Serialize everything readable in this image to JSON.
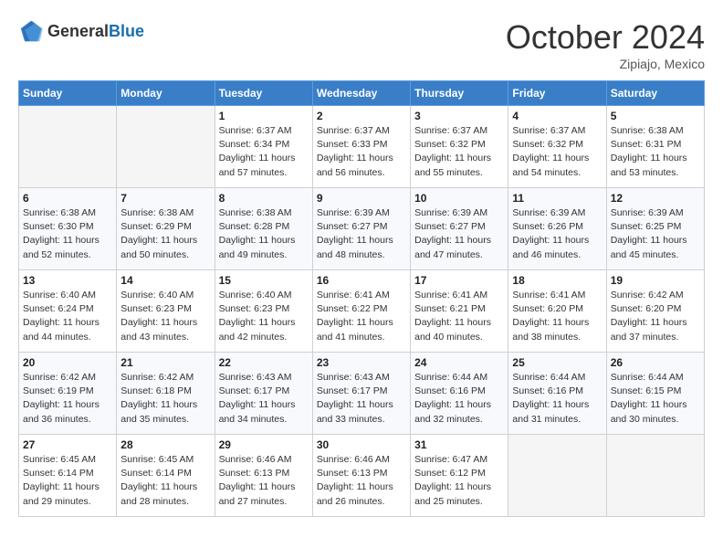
{
  "header": {
    "logo_general": "General",
    "logo_blue": "Blue",
    "month_title": "October 2024",
    "location": "Zipiajo, Mexico"
  },
  "weekdays": [
    "Sunday",
    "Monday",
    "Tuesday",
    "Wednesday",
    "Thursday",
    "Friday",
    "Saturday"
  ],
  "weeks": [
    [
      null,
      null,
      {
        "day": 1,
        "sunrise": "6:37 AM",
        "sunset": "6:34 PM",
        "daylight": "11 hours and 57 minutes."
      },
      {
        "day": 2,
        "sunrise": "6:37 AM",
        "sunset": "6:33 PM",
        "daylight": "11 hours and 56 minutes."
      },
      {
        "day": 3,
        "sunrise": "6:37 AM",
        "sunset": "6:32 PM",
        "daylight": "11 hours and 55 minutes."
      },
      {
        "day": 4,
        "sunrise": "6:37 AM",
        "sunset": "6:32 PM",
        "daylight": "11 hours and 54 minutes."
      },
      {
        "day": 5,
        "sunrise": "6:38 AM",
        "sunset": "6:31 PM",
        "daylight": "11 hours and 53 minutes."
      }
    ],
    [
      {
        "day": 6,
        "sunrise": "6:38 AM",
        "sunset": "6:30 PM",
        "daylight": "11 hours and 52 minutes."
      },
      {
        "day": 7,
        "sunrise": "6:38 AM",
        "sunset": "6:29 PM",
        "daylight": "11 hours and 50 minutes."
      },
      {
        "day": 8,
        "sunrise": "6:38 AM",
        "sunset": "6:28 PM",
        "daylight": "11 hours and 49 minutes."
      },
      {
        "day": 9,
        "sunrise": "6:39 AM",
        "sunset": "6:27 PM",
        "daylight": "11 hours and 48 minutes."
      },
      {
        "day": 10,
        "sunrise": "6:39 AM",
        "sunset": "6:27 PM",
        "daylight": "11 hours and 47 minutes."
      },
      {
        "day": 11,
        "sunrise": "6:39 AM",
        "sunset": "6:26 PM",
        "daylight": "11 hours and 46 minutes."
      },
      {
        "day": 12,
        "sunrise": "6:39 AM",
        "sunset": "6:25 PM",
        "daylight": "11 hours and 45 minutes."
      }
    ],
    [
      {
        "day": 13,
        "sunrise": "6:40 AM",
        "sunset": "6:24 PM",
        "daylight": "11 hours and 44 minutes."
      },
      {
        "day": 14,
        "sunrise": "6:40 AM",
        "sunset": "6:23 PM",
        "daylight": "11 hours and 43 minutes."
      },
      {
        "day": 15,
        "sunrise": "6:40 AM",
        "sunset": "6:23 PM",
        "daylight": "11 hours and 42 minutes."
      },
      {
        "day": 16,
        "sunrise": "6:41 AM",
        "sunset": "6:22 PM",
        "daylight": "11 hours and 41 minutes."
      },
      {
        "day": 17,
        "sunrise": "6:41 AM",
        "sunset": "6:21 PM",
        "daylight": "11 hours and 40 minutes."
      },
      {
        "day": 18,
        "sunrise": "6:41 AM",
        "sunset": "6:20 PM",
        "daylight": "11 hours and 38 minutes."
      },
      {
        "day": 19,
        "sunrise": "6:42 AM",
        "sunset": "6:20 PM",
        "daylight": "11 hours and 37 minutes."
      }
    ],
    [
      {
        "day": 20,
        "sunrise": "6:42 AM",
        "sunset": "6:19 PM",
        "daylight": "11 hours and 36 minutes."
      },
      {
        "day": 21,
        "sunrise": "6:42 AM",
        "sunset": "6:18 PM",
        "daylight": "11 hours and 35 minutes."
      },
      {
        "day": 22,
        "sunrise": "6:43 AM",
        "sunset": "6:17 PM",
        "daylight": "11 hours and 34 minutes."
      },
      {
        "day": 23,
        "sunrise": "6:43 AM",
        "sunset": "6:17 PM",
        "daylight": "11 hours and 33 minutes."
      },
      {
        "day": 24,
        "sunrise": "6:44 AM",
        "sunset": "6:16 PM",
        "daylight": "11 hours and 32 minutes."
      },
      {
        "day": 25,
        "sunrise": "6:44 AM",
        "sunset": "6:16 PM",
        "daylight": "11 hours and 31 minutes."
      },
      {
        "day": 26,
        "sunrise": "6:44 AM",
        "sunset": "6:15 PM",
        "daylight": "11 hours and 30 minutes."
      }
    ],
    [
      {
        "day": 27,
        "sunrise": "6:45 AM",
        "sunset": "6:14 PM",
        "daylight": "11 hours and 29 minutes."
      },
      {
        "day": 28,
        "sunrise": "6:45 AM",
        "sunset": "6:14 PM",
        "daylight": "11 hours and 28 minutes."
      },
      {
        "day": 29,
        "sunrise": "6:46 AM",
        "sunset": "6:13 PM",
        "daylight": "11 hours and 27 minutes."
      },
      {
        "day": 30,
        "sunrise": "6:46 AM",
        "sunset": "6:13 PM",
        "daylight": "11 hours and 26 minutes."
      },
      {
        "day": 31,
        "sunrise": "6:47 AM",
        "sunset": "6:12 PM",
        "daylight": "11 hours and 25 minutes."
      },
      null,
      null
    ]
  ],
  "labels": {
    "sunrise": "Sunrise:",
    "sunset": "Sunset:",
    "daylight": "Daylight:"
  }
}
